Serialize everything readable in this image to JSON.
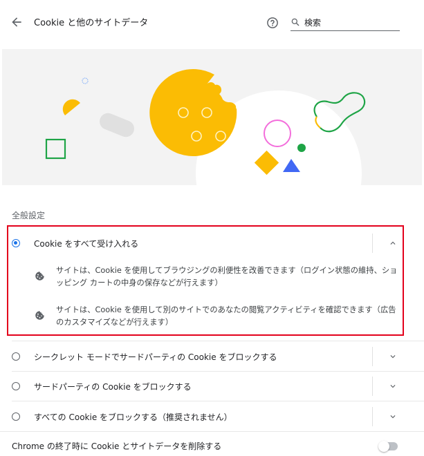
{
  "header": {
    "title": "Cookie と他のサイトデータ",
    "search": {
      "value": "検索",
      "placeholder": "検索"
    }
  },
  "section_title": "全般設定",
  "options": [
    {
      "label": "Cookie をすべて受け入れる",
      "selected": true,
      "expanded": true
    },
    {
      "label": "シークレット モードでサードパーティの Cookie をブロックする",
      "selected": false,
      "expanded": false
    },
    {
      "label": "サードパーティの Cookie をブロックする",
      "selected": false,
      "expanded": false
    },
    {
      "label": "すべての Cookie をブロックする（推奨されません）",
      "selected": false,
      "expanded": false
    }
  ],
  "details": [
    {
      "icon": "cookie-icon",
      "text": "サイトは、Cookie を使用してブラウジングの利便性を改善できます（ログイン状態の維持、ショッピング カートの中身の保存などが行えます）"
    },
    {
      "icon": "cookie-icon",
      "text": "サイトは、Cookie を使用して別のサイトでのあなたの閲覧アクティビティを確認できます（広告のカスタマイズなどが行えます）"
    }
  ],
  "clear_on_exit": {
    "label": "Chrome の終了時に Cookie とサイトデータを削除する",
    "enabled": false
  },
  "colors": {
    "accent": "#1a73e8",
    "highlight": "#e3001b",
    "cookie": "#fbbc04",
    "green": "#1ea446",
    "pink": "#f36ddb",
    "blue": "#4168f4"
  }
}
